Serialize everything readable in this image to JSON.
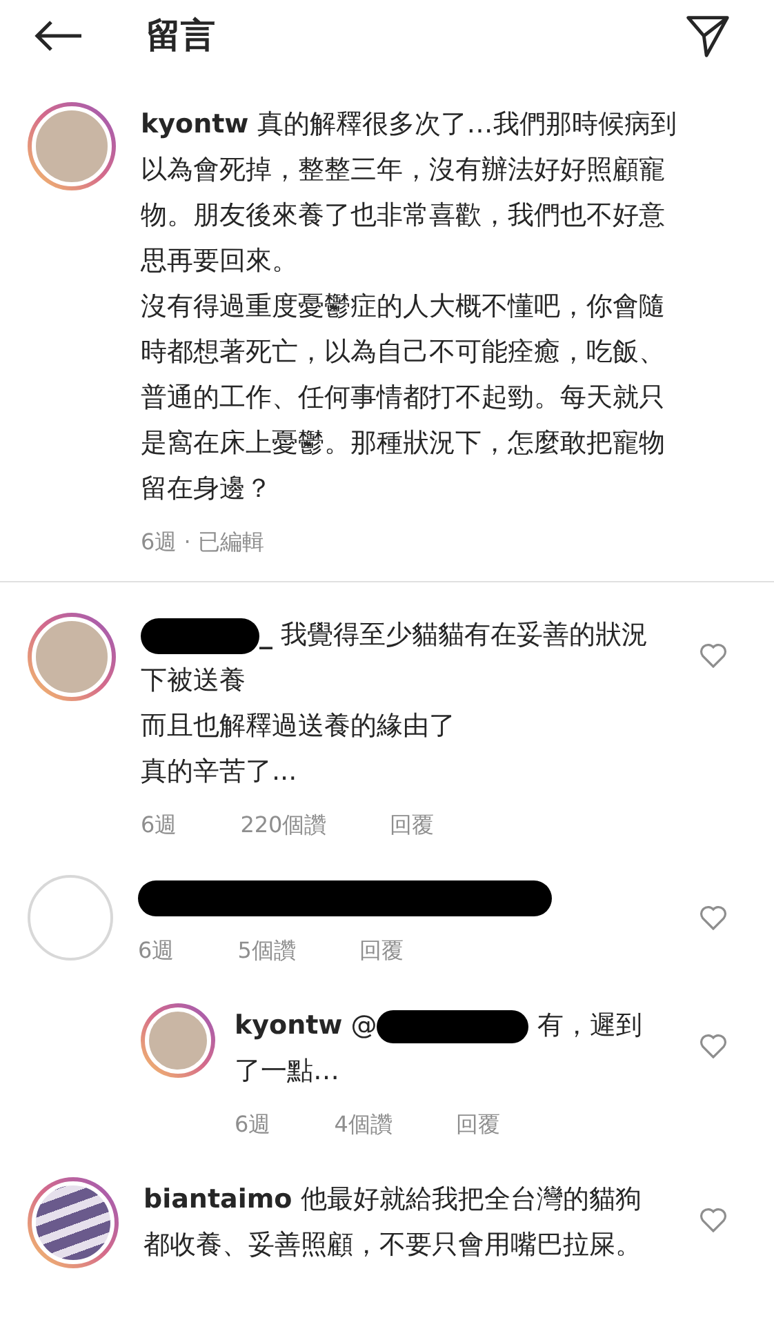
{
  "header": {
    "title": "留言"
  },
  "comments": [
    {
      "kind": "comment",
      "avatar": {
        "kind": "photo"
      },
      "username": "kyontw",
      "paragraphs": [
        "真的解釋很多次了…我們那時候病到以為會死掉，整整三年，沒有辦法好好照顧寵物。朋友後來養了也非常喜歡，我們也不好意思再要回來。",
        "沒有得過重度憂鬱症的人大概不懂吧，你會隨時都想著死亡，以為自己不可能痊癒，吃飯、普通的工作、任何事情都打不起勁。每天就只是窩在床上憂鬱。那種狀況下，怎麼敢把寵物留在身邊？"
      ],
      "meta": [
        "6週 · 已編輯"
      ],
      "heart": false,
      "divider": true
    },
    {
      "kind": "comment",
      "avatar": {
        "kind": "photo"
      },
      "redaction": {
        "kind": "username"
      },
      "username": "_",
      "paragraphs": [
        "我覺得至少貓貓有在妥善的狀況下被送養",
        "而且也解釋過送養的緣由了",
        "真的辛苦了..."
      ],
      "meta": [
        "6週",
        "220個讚",
        "回覆"
      ],
      "heart": true
    },
    {
      "kind": "comment",
      "avatar": {
        "kind": "blank"
      },
      "redaction": {
        "kind": "all"
      },
      "meta": [
        "6週",
        "5個讚",
        "回覆"
      ],
      "heart": true
    },
    {
      "kind": "reply",
      "avatar": {
        "kind": "photo"
      },
      "redaction": {
        "kind": "mention"
      },
      "username": "kyontw",
      "mention": "@",
      "paragraphs": [
        "有，遲到了一點…"
      ],
      "meta": [
        "6週",
        "4個讚",
        "回覆"
      ],
      "heart": true
    },
    {
      "kind": "comment",
      "avatar": {
        "kind": "drawing"
      },
      "username": "biantaimo",
      "paragraphs": [
        "他最好就給我把全台灣的貓狗都收養、妥善照顧，不要只會用嘴巴拉屎。"
      ],
      "heart": true
    }
  ]
}
